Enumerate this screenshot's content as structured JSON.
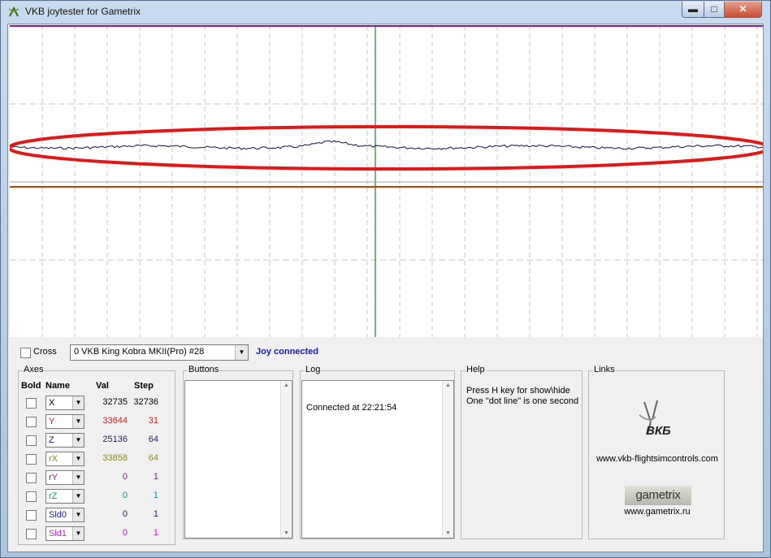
{
  "window": {
    "title": "VKB joytester for Gametrix",
    "min_glyph": "▬",
    "max_glyph": "□",
    "close_glyph": "✕"
  },
  "toolbar": {
    "cross_label": "Cross",
    "joystick_selected": "0 VKB King Kobra MKII(Pro)  #28",
    "status": "Joy connected"
  },
  "axes": {
    "title": "Axes",
    "headers": {
      "bold": "Bold",
      "name": "Name",
      "val": "Val",
      "step": "Step"
    },
    "rows": [
      {
        "name": "X",
        "val": "32735",
        "step": "32736",
        "color": "#000000"
      },
      {
        "name": "Y",
        "val": "33644",
        "step": "31",
        "color": "#d02020"
      },
      {
        "name": "Z",
        "val": "25136",
        "step": "64",
        "color": "#1c1c7a"
      },
      {
        "name": "rX",
        "val": "33858",
        "step": "64",
        "color": "#8a8a18"
      },
      {
        "name": "rY",
        "val": "0",
        "step": "1",
        "color": "#8a1aa0"
      },
      {
        "name": "rZ",
        "val": "0",
        "step": "1",
        "color": "#1a8a8a"
      },
      {
        "name": "Sld0",
        "val": "0",
        "step": "1",
        "color": "#1c1c7a"
      },
      {
        "name": "Sld1",
        "val": "0",
        "step": "1",
        "color": "#c020c0"
      }
    ]
  },
  "buttons_group": {
    "title": "Buttons"
  },
  "log_group": {
    "title": "Log",
    "lines": [
      "Connected at 22:21:54"
    ]
  },
  "help_group": {
    "title": "Help",
    "lines": [
      "Press H key for show\\hide",
      "One \"dot line\" is one second"
    ]
  },
  "links_group": {
    "title": "Links",
    "vkb_logo_text": "ВКБ",
    "vkb_url": "www.vkb-flightsimcontrols.com",
    "gametrix_logo_text": "gametrix",
    "gametrix_url": "www.gametrix.ru"
  },
  "colors": {
    "top_trace": "#8a1aa0",
    "wave_trace": "#101040",
    "mid_trace": "#a0a0a0",
    "bottom_trace": "#c04000",
    "center_line": "#006000",
    "highlight_ellipse": "#e01818",
    "grid": "#c8c8c8"
  }
}
